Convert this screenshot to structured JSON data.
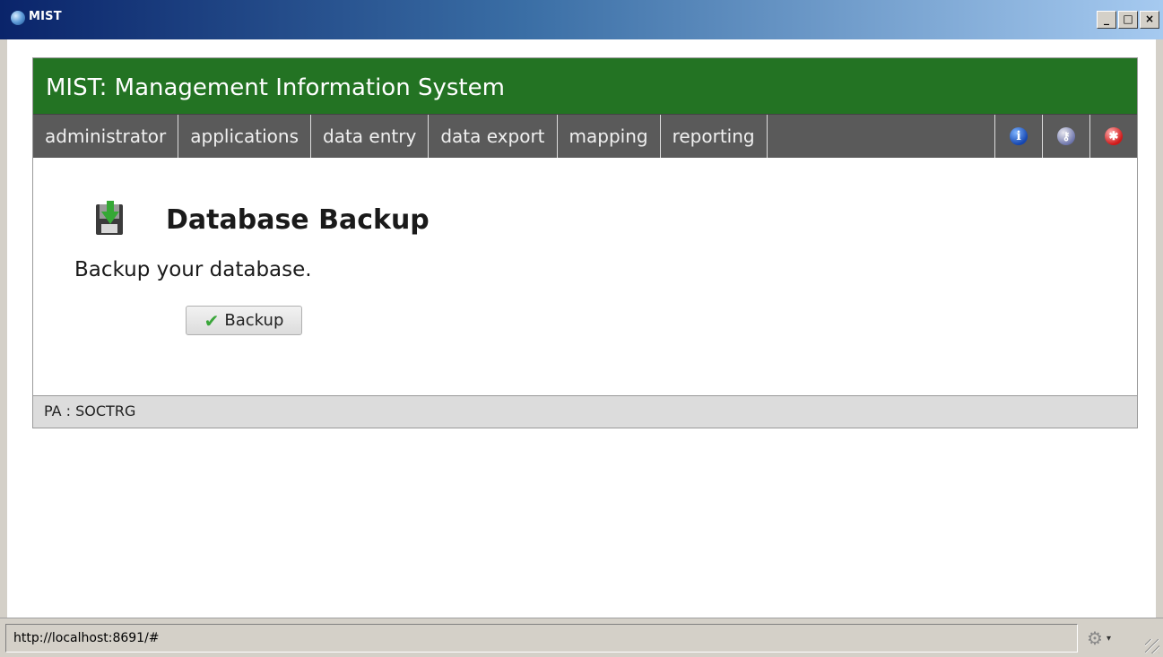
{
  "window": {
    "title": "MIST",
    "controls": {
      "minimize": "_",
      "maximize": "□",
      "close": "×"
    }
  },
  "header": {
    "title": "MIST: Management Information System"
  },
  "nav": {
    "items": [
      "administrator",
      "applications",
      "data entry",
      "data export",
      "mapping",
      "reporting"
    ],
    "icons": [
      "info-icon",
      "key-icon",
      "help-icon"
    ]
  },
  "page": {
    "icon": "database-backup-icon",
    "title": "Database Backup",
    "description": "Backup your database.",
    "button_label": "Backup"
  },
  "footer": {
    "text": "PA : SOCTRG"
  },
  "status": {
    "url": "http://localhost:8691/#"
  },
  "colors": {
    "header_bg": "#237323",
    "nav_bg": "#5a5a5a",
    "footer_bg": "#dcdcdc"
  }
}
